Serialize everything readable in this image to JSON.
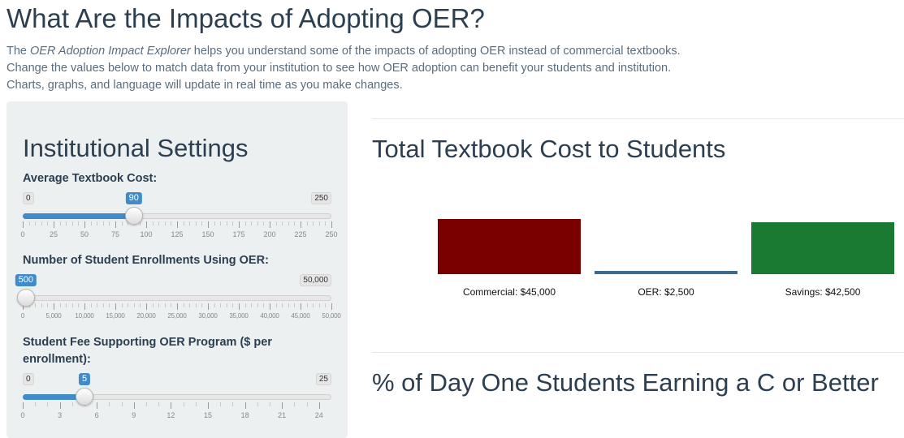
{
  "page": {
    "title": "What Are the Impacts of Adopting OER?",
    "intro_prefix": "The ",
    "intro_emphasis": "OER Adoption Impact Explorer",
    "intro_line1_suffix": " helps you understand some of the impacts of adopting OER instead of commercial textbooks.",
    "intro_line2": "Change the values below to match data from your institution to see how OER adoption can benefit your students and institution.",
    "intro_line3": "Charts, graphs, and language will update in real time as you make changes."
  },
  "sidebar": {
    "title": "Institutional Settings",
    "sliders": [
      {
        "label": "Average Textbook Cost:",
        "min": 0,
        "max": 250,
        "value": 90,
        "min_label": "0",
        "max_label": "250",
        "value_label": "90",
        "ticks": [
          "0",
          "25",
          "50",
          "75",
          "100",
          "125",
          "150",
          "175",
          "200",
          "225",
          "250"
        ],
        "minor_per_major": 4
      },
      {
        "label": "Number of Student Enrollments Using OER:",
        "min": 0,
        "max": 50000,
        "value": 500,
        "min_label": "0",
        "max_label": "50,000",
        "value_label": "500",
        "ticks": [
          "0",
          "5,000",
          "10,000",
          "15,000",
          "20,000",
          "25,000",
          "30,000",
          "35,000",
          "40,000",
          "45,000",
          "50,000"
        ],
        "minor_per_major": 4
      },
      {
        "label": "Student Fee Supporting OER Program ($ per enrollment):",
        "min": 0,
        "max": 25,
        "value": 5,
        "min_label": "0",
        "max_label": "25",
        "value_label": "5",
        "ticks": [
          "0",
          "3",
          "6",
          "9",
          "12",
          "15",
          "18",
          "21",
          "24"
        ],
        "tick_step": 3,
        "minor_per_major": 2
      }
    ]
  },
  "main": {
    "cost_section_title": "Total Textbook Cost to Students",
    "outcomes_section_title": "% of Day One Students Earning a C or Better"
  },
  "chart_data": {
    "type": "bar",
    "categories": [
      "Commercial: $45,000",
      "OER: $2,500",
      "Savings: $42,500"
    ],
    "values": [
      45000,
      2500,
      42500
    ],
    "colors": [
      "#7a0000",
      "#3e6a8f",
      "#1a7a32"
    ]
  }
}
